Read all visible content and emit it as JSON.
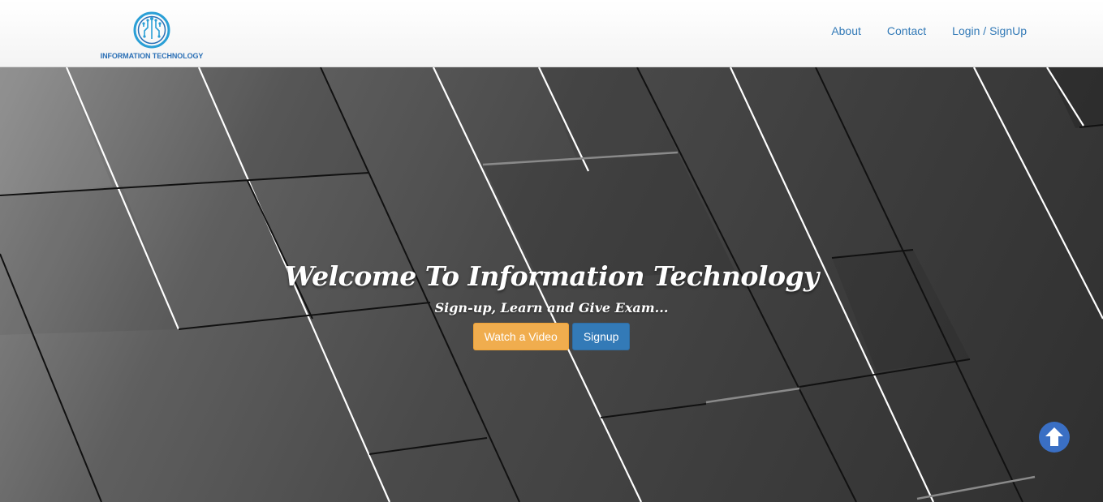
{
  "brand": {
    "logo_icon": "circuit-globe-icon",
    "name": "INFORMATION TECHNOLOGY",
    "color": "#2a6fb5"
  },
  "nav": {
    "about": "About",
    "contact": "Contact",
    "login": "Login / SignUp",
    "link_color": "#337ab7"
  },
  "hero": {
    "title": "Welcome To Information Technology",
    "subtitle": "Sign-up, Learn and Give Exam...",
    "watch_button": "Watch a Video",
    "signup_button": "Signup",
    "watch_color": "#f0ad4e",
    "signup_color": "#337ab7"
  },
  "scroll_top": {
    "icon": "arrow-up-circle-icon",
    "color": "#3a6fc4"
  }
}
